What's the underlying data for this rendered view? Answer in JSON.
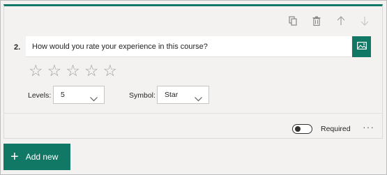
{
  "question": {
    "number": "2.",
    "text": "How would you rate your experience in this course?",
    "rating_count": 5
  },
  "toolbar": {
    "icons": [
      "copy-icon",
      "trash-icon",
      "arrow-up-icon",
      "arrow-down-icon"
    ]
  },
  "levels": {
    "label": "Levels:",
    "value": "5"
  },
  "symbol": {
    "label": "Symbol:",
    "value": "Star"
  },
  "required": {
    "label": "Required",
    "enabled": false
  },
  "more_label": "···",
  "add_new": {
    "plus": "+",
    "label": "Add new"
  },
  "colors": {
    "accent": "#117865",
    "star_outline": "#a19f9d"
  }
}
